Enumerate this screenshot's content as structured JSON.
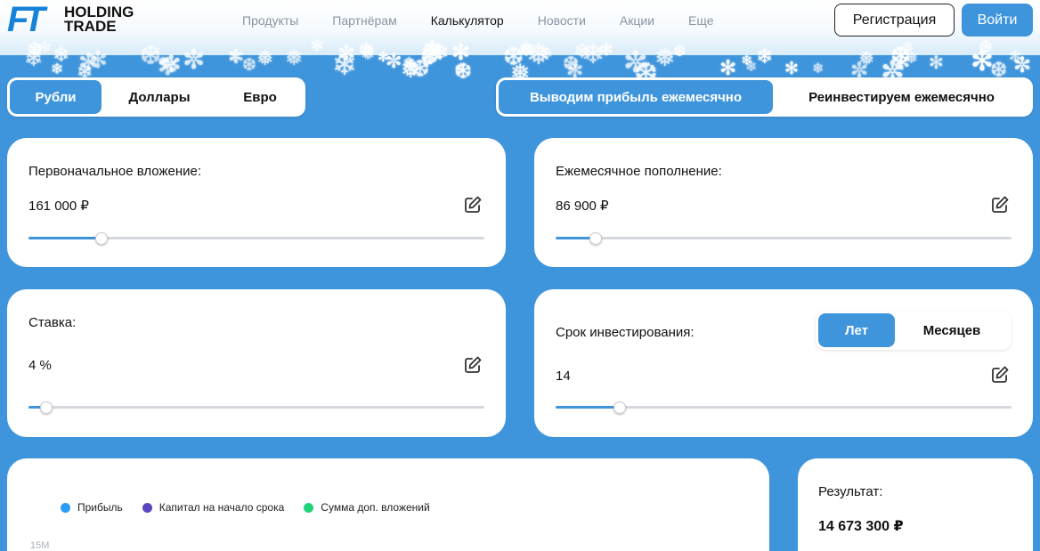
{
  "header": {
    "logo_line1": "HOLDING",
    "logo_line2": "TRADE",
    "logo_mark": "FT",
    "nav": [
      {
        "label": "Продукты",
        "active": false
      },
      {
        "label": "Партнёрам",
        "active": false
      },
      {
        "label": "Калькулятор",
        "active": true
      },
      {
        "label": "Новости",
        "active": false
      },
      {
        "label": "Акции",
        "active": false
      },
      {
        "label": "Еще",
        "active": false
      }
    ],
    "register_label": "Регистрация",
    "login_label": "Войти"
  },
  "currency_toggle": {
    "options": [
      "Рубли",
      "Доллары",
      "Евро"
    ],
    "selected": "Рубли"
  },
  "profit_mode_toggle": {
    "options": [
      "Выводим прибыль ежемесячно",
      "Реинвестируем ежемесячно"
    ],
    "selected": "Выводим прибыль ежемесячно"
  },
  "initial_investment": {
    "label": "Первоначальное вложение:",
    "value": "161 000 ₽",
    "slider_fraction": 0.16
  },
  "monthly_topup": {
    "label": "Ежемесячное пополнение:",
    "value": "86 900 ₽",
    "slider_fraction": 0.087
  },
  "rate": {
    "label": "Ставка:",
    "value": "4 %",
    "slider_fraction": 0.04
  },
  "term": {
    "label": "Срок инвестирования:",
    "value": "14",
    "unit_options": [
      "Лет",
      "Месяцев"
    ],
    "unit_selected": "Лет",
    "slider_fraction": 0.14
  },
  "chart": {
    "legend": [
      {
        "label": "Прибыль",
        "color": "#2a9df4"
      },
      {
        "label": "Капитал на начало срока",
        "color": "#5b45c2"
      },
      {
        "label": "Сумма доп. вложений",
        "color": "#1fd37a"
      }
    ],
    "top_tick": "15M"
  },
  "result": {
    "label": "Результат:",
    "value": "14 673 300 ₽"
  },
  "colors": {
    "accent": "#3f95dc",
    "background": "#3f95dc"
  }
}
